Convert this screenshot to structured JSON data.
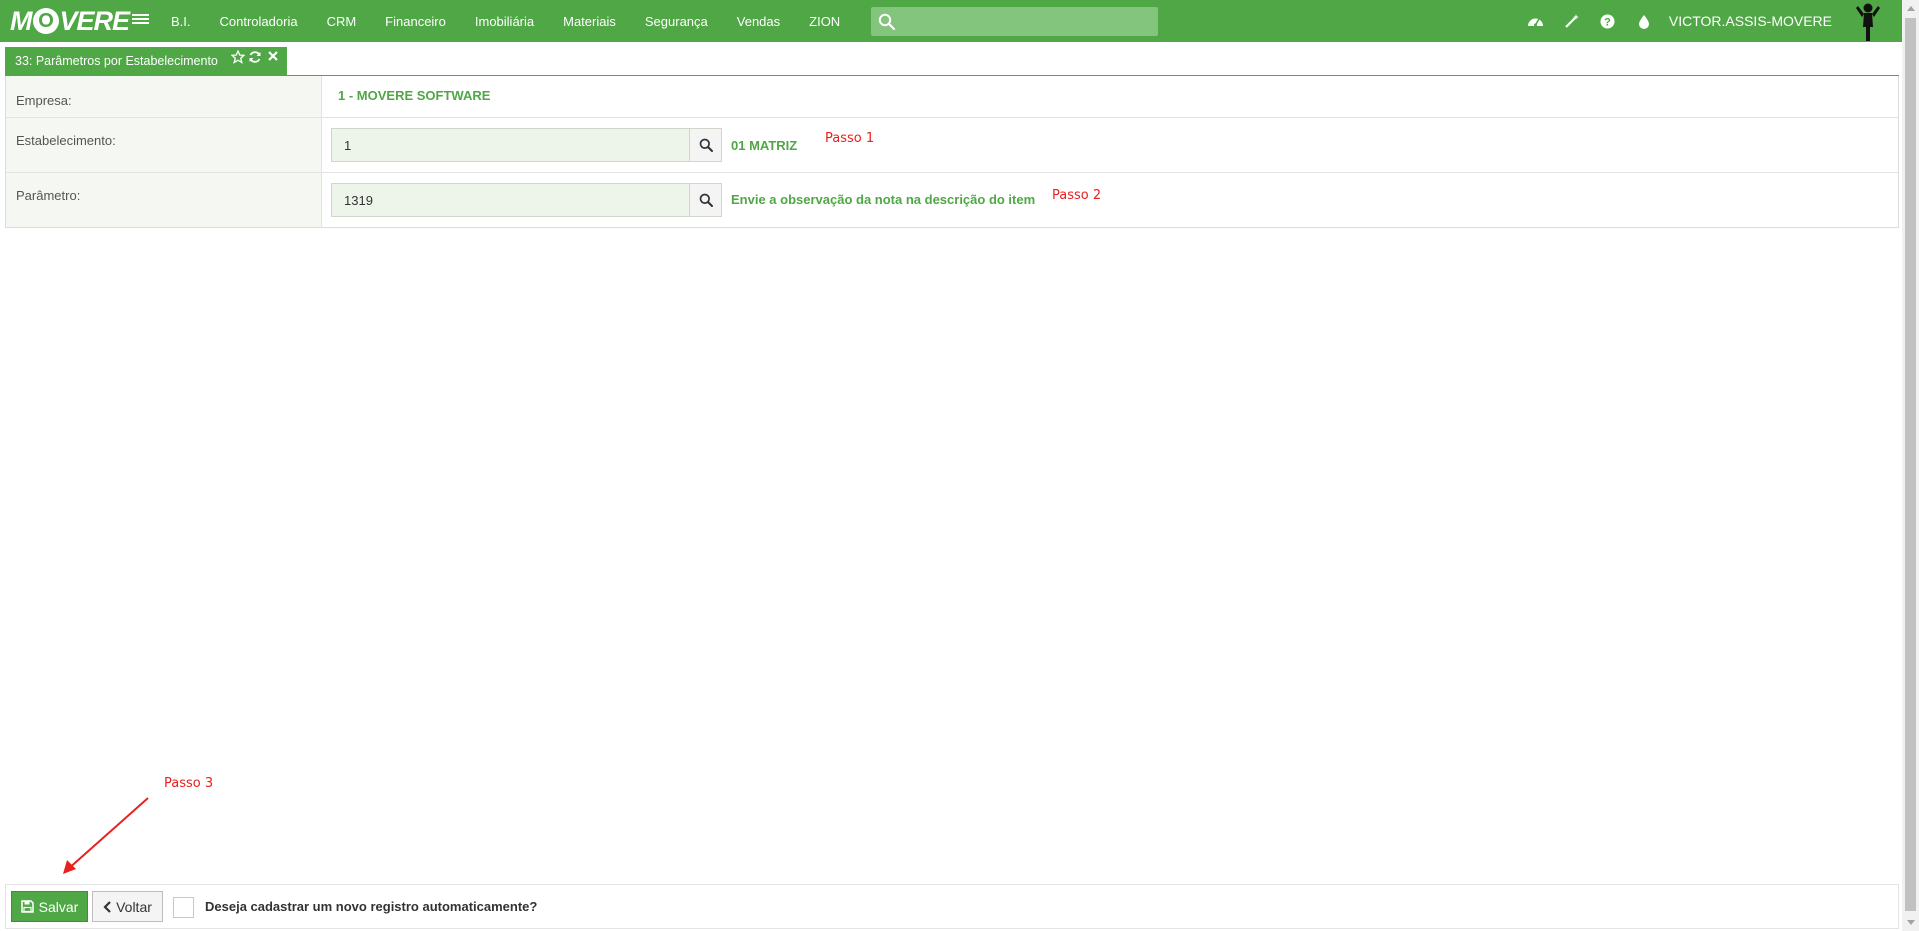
{
  "app": {
    "logo_text_pre": "M",
    "logo_text_o": "O",
    "logo_text_post": "VERE"
  },
  "nav": {
    "items": [
      "B.I.",
      "Controladoria",
      "CRM",
      "Financeiro",
      "Imobiliária",
      "Materiais",
      "Segurança",
      "Vendas",
      "ZION"
    ],
    "search_placeholder": ""
  },
  "header": {
    "icons": [
      "dashboard-icon",
      "magic-wand-icon",
      "help-icon",
      "theme-drop-icon"
    ],
    "username": "VICTOR.ASSIS-MOVERE"
  },
  "tab": {
    "title": "33: Parâmetros por Estabelecimento"
  },
  "form": {
    "empresa": {
      "label": "Empresa:",
      "value": "1 - MOVERE SOFTWARE"
    },
    "estabelecimento": {
      "label": "Estabelecimento:",
      "input": "1",
      "description": "01 MATRIZ"
    },
    "parametro": {
      "label": "Parâmetro:",
      "input": "1319",
      "description": "Envie a observação da nota na descrição do item"
    }
  },
  "annotations": {
    "step1": "Passo 1",
    "step2": "Passo 2",
    "step3": "Passo 3"
  },
  "footer": {
    "save_label": "Salvar",
    "back_label": "Voltar",
    "checkbox_label": "Deseja cadastrar um novo registro automaticamente?",
    "checkbox_checked": false
  },
  "colors": {
    "brand_green": "#4fa745",
    "annotation_red": "#e8201e"
  }
}
